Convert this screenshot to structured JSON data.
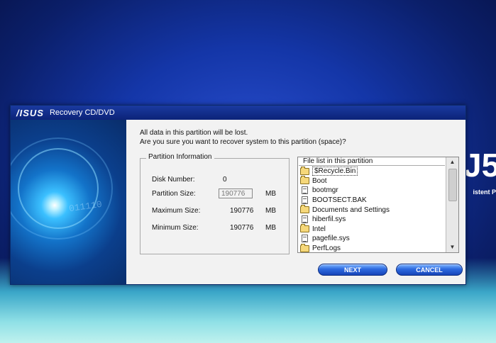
{
  "window": {
    "brand": "/ISUS",
    "title": "Recovery CD/DVD"
  },
  "message": {
    "line1": "All data in this partition will be lost.",
    "line2": "Are you sure you want to recover system to this partition (space)?"
  },
  "partition_info": {
    "legend": "Partition Information",
    "disk_number_label": "Disk Number:",
    "disk_number_value": "0",
    "partition_size_label": "Partition Size:",
    "partition_size_value": "190776",
    "partition_size_unit": "MB",
    "max_size_label": "Maximum Size:",
    "max_size_value": "190776",
    "max_size_unit": "MB",
    "min_size_label": "Minimum Size:",
    "min_size_value": "190776",
    "min_size_unit": "MB"
  },
  "file_list": {
    "header": "File list in this partition",
    "items": [
      {
        "name": "$Recycle.Bin",
        "type": "folder",
        "selected": true
      },
      {
        "name": "Boot",
        "type": "folder"
      },
      {
        "name": "bootmgr",
        "type": "file"
      },
      {
        "name": "BOOTSECT.BAK",
        "type": "file"
      },
      {
        "name": "Documents and Settings",
        "type": "folder"
      },
      {
        "name": "hiberfil.sys",
        "type": "file"
      },
      {
        "name": "Intel",
        "type": "folder"
      },
      {
        "name": "pagefile.sys",
        "type": "file"
      },
      {
        "name": "PerfLogs",
        "type": "folder"
      }
    ]
  },
  "buttons": {
    "next": "NEXT",
    "cancel": "CANCEL"
  },
  "background": {
    "logo_text": "J5",
    "side_text": "istent P",
    "side_art_digits": "011110"
  }
}
